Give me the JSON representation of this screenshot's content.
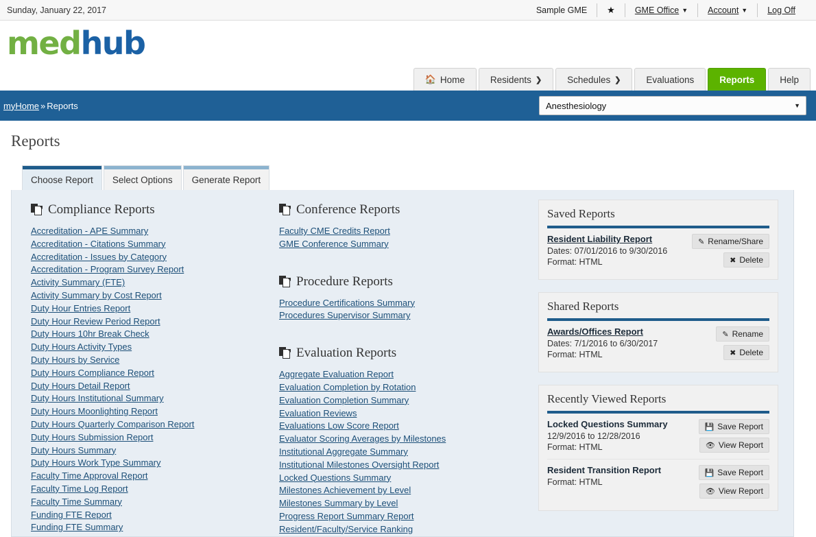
{
  "utility": {
    "date": "Sunday, January 22, 2017",
    "institution": "Sample GME",
    "star_icon": "star-icon",
    "gme_office": "GME Office",
    "account": "Account",
    "log_off": "Log Off"
  },
  "brand": {
    "logo_first": "med",
    "logo_second": "hub",
    "green": "#72b043",
    "blue": "#1b61a5"
  },
  "nav": {
    "items": [
      {
        "label": "Home",
        "icon": "home-icon",
        "chevron": "",
        "active": false
      },
      {
        "label": "Residents",
        "icon": "",
        "chevron": "❯",
        "active": false
      },
      {
        "label": "Schedules",
        "icon": "",
        "chevron": "❯",
        "active": false
      },
      {
        "label": "Evaluations",
        "icon": "",
        "chevron": "",
        "active": false
      },
      {
        "label": "Reports",
        "icon": "",
        "chevron": "",
        "active": true
      },
      {
        "label": "Help",
        "icon": "",
        "chevron": "",
        "active": false
      }
    ],
    "active_color": "#5cb300"
  },
  "breadcrumb": {
    "home_label": "myHome",
    "separator": "»",
    "current": "Reports",
    "bar_color": "#1f6096"
  },
  "department_select": {
    "value": "Anesthesiology",
    "arrow": "▼"
  },
  "page": {
    "title": "Reports"
  },
  "tabs": [
    {
      "label": "Choose Report",
      "active": true
    },
    {
      "label": "Select Options",
      "active": false
    },
    {
      "label": "Generate Report",
      "active": false
    }
  ],
  "sections": {
    "compliance": {
      "title": "Compliance Reports",
      "icon": "copy-documents-icon",
      "links": [
        "Accreditation - APE Summary",
        "Accreditation - Citations Summary",
        "Accreditation - Issues by Category",
        "Accreditation - Program Survey Report",
        "Activity Summary (FTE)",
        "Activity Summary by Cost Report",
        "Duty Hour Entries Report",
        "Duty Hour Review Period Report",
        "Duty Hours 10hr Break Check",
        "Duty Hours Activity Types",
        "Duty Hours by Service",
        "Duty Hours Compliance Report",
        "Duty Hours Detail Report",
        "Duty Hours Institutional Summary",
        "Duty Hours Moonlighting Report",
        "Duty Hours Quarterly Comparison Report",
        "Duty Hours Submission Report",
        "Duty Hours Summary",
        "Duty Hours Work Type Summary",
        "Faculty Time Approval Report",
        "Faculty Time Log Report",
        "Faculty Time Summary",
        "Funding FTE Report",
        "Funding FTE Summary"
      ]
    },
    "conference": {
      "title": "Conference Reports",
      "icon": "copy-documents-icon",
      "links": [
        "Faculty CME Credits Report",
        "GME Conference Summary"
      ]
    },
    "procedure": {
      "title": "Procedure Reports",
      "icon": "copy-documents-icon",
      "links": [
        "Procedure Certifications Summary",
        "Procedures Supervisor Summary"
      ]
    },
    "evaluation": {
      "title": "Evaluation Reports",
      "icon": "copy-documents-icon",
      "links": [
        "Aggregate Evaluation Report",
        "Evaluation Completion by Rotation",
        "Evaluation Completion Summary",
        "Evaluation Reviews",
        "Evaluations Low Score Report",
        "Evaluator Scoring Averages by Milestones",
        "Institutional Aggregate Summary",
        "Institutional Milestones Oversight Report",
        "Locked Questions Summary",
        "Milestones Achievement by Level",
        "Milestones Summary by Level",
        "Progress Report Summary Report",
        "Resident/Faculty/Service Ranking"
      ]
    }
  },
  "panels": {
    "saved": {
      "title": "Saved Reports",
      "items": [
        {
          "name": "Resident Liability Report",
          "dates": "Dates: 07/01/2016 to 9/30/2016",
          "format": "Format: HTML",
          "actions": [
            {
              "label": "Rename/Share",
              "icon": "pencil-icon",
              "glyph": "✎"
            },
            {
              "label": "Delete",
              "icon": "close-x-icon",
              "glyph": "✖"
            }
          ]
        }
      ]
    },
    "shared": {
      "title": "Shared Reports",
      "items": [
        {
          "name": "Awards/Offices Report",
          "dates": "Dates: 7/1/2016 to 6/30/2017",
          "format": "Format: HTML",
          "actions": [
            {
              "label": "Rename",
              "icon": "pencil-icon",
              "glyph": "✎"
            },
            {
              "label": "Delete",
              "icon": "close-x-icon",
              "glyph": "✖"
            }
          ]
        }
      ]
    },
    "recent": {
      "title": "Recently Viewed Reports",
      "items": [
        {
          "name": "Locked Questions Summary",
          "dates": "12/9/2016 to 12/28/2016",
          "format": "Format: HTML",
          "actions": [
            {
              "label": "Save Report",
              "icon": "floppy-save-icon",
              "glyph": "Ὃe"
            },
            {
              "label": "View Report",
              "icon": "eye-icon",
              "glyph": "◉"
            }
          ]
        },
        {
          "name": "Resident Transition Report",
          "dates": "",
          "format": "Format: HTML",
          "actions": [
            {
              "label": "Save Report",
              "icon": "floppy-save-icon",
              "glyph": "Ὃe"
            },
            {
              "label": "View Report",
              "icon": "eye-icon",
              "glyph": "◉"
            }
          ]
        }
      ]
    }
  }
}
